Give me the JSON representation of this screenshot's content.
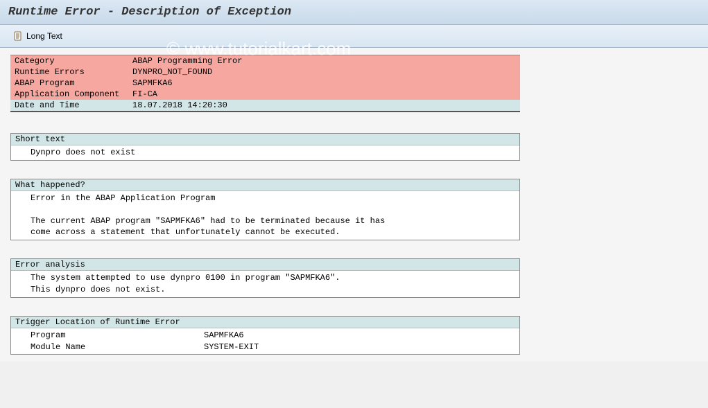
{
  "header": {
    "title": "Runtime Error - Description of Exception"
  },
  "toolbar": {
    "long_text_label": "Long Text"
  },
  "info": {
    "rows": [
      {
        "label": "Category",
        "value": "ABAP Programming Error"
      },
      {
        "label": "Runtime Errors",
        "value": "DYNPRO_NOT_FOUND"
      },
      {
        "label": "ABAP Program",
        "value": "SAPMFKA6"
      },
      {
        "label": "Application Component",
        "value": "FI-CA"
      },
      {
        "label": "Date and Time",
        "value": "18.07.2018 14:20:30"
      }
    ]
  },
  "sections": {
    "short_text": {
      "header": "Short text",
      "lines": [
        "Dynpro does not exist"
      ]
    },
    "what_happened": {
      "header": "What happened?",
      "lines": [
        "Error in the ABAP Application Program",
        "",
        "The current ABAP program \"SAPMFKA6\" had to be terminated because it has",
        "come across a statement that unfortunately cannot be executed."
      ]
    },
    "error_analysis": {
      "header": "Error analysis",
      "lines": [
        "The system attempted to use dynpro 0100 in program \"SAPMFKA6\".",
        "This dynpro does not exist."
      ]
    },
    "trigger": {
      "header": "Trigger Location of Runtime Error",
      "kv": [
        {
          "k": "Program",
          "v": "SAPMFKA6"
        },
        {
          "k": "Module Name",
          "v": "SYSTEM-EXIT"
        }
      ]
    }
  },
  "watermark": "© www.tutorialkart.com"
}
